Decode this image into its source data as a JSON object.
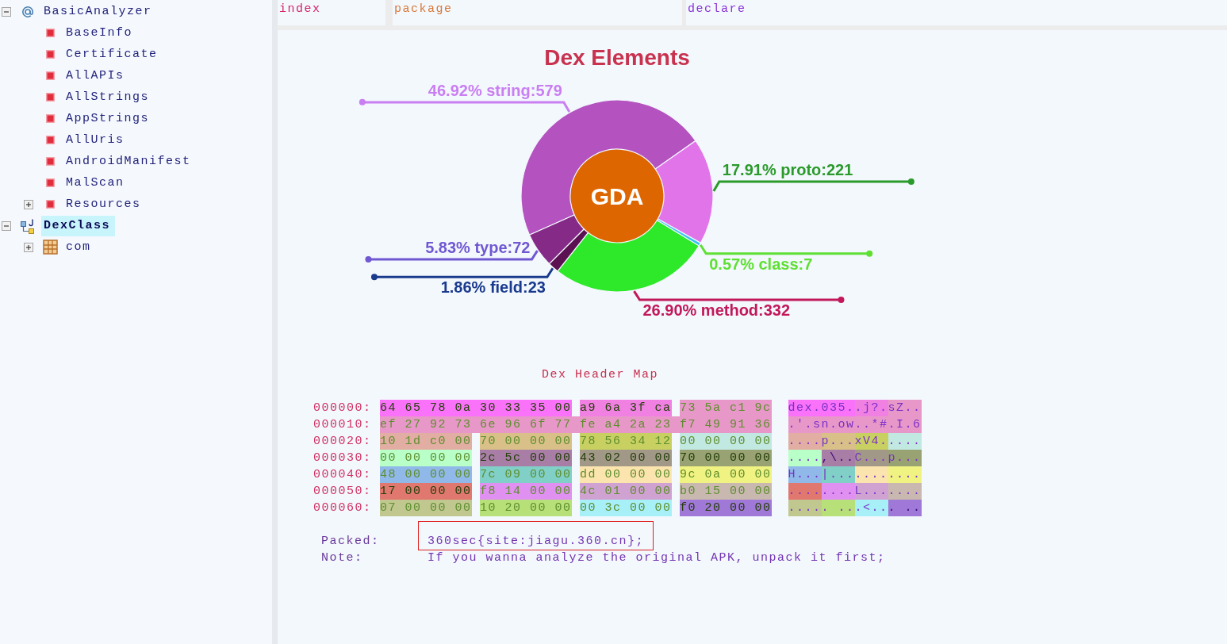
{
  "sidebar": {
    "tree": [
      {
        "label": "BasicAnalyzer",
        "kind": "analyzer",
        "expanded": true,
        "selected": false,
        "children": [
          {
            "label": "BaseInfo",
            "kind": "report",
            "selected": false
          },
          {
            "label": "Certificate",
            "kind": "report",
            "selected": false
          },
          {
            "label": "AllAPIs",
            "kind": "report",
            "selected": false
          },
          {
            "label": "AllStrings",
            "kind": "report",
            "selected": false
          },
          {
            "label": "AppStrings",
            "kind": "report",
            "selected": false
          },
          {
            "label": "AllUris",
            "kind": "report",
            "selected": false
          },
          {
            "label": "AndroidManifest",
            "kind": "report",
            "selected": false
          },
          {
            "label": "MalScan",
            "kind": "report",
            "selected": false
          },
          {
            "label": "Resources",
            "kind": "report",
            "expanded": false,
            "selected": false
          }
        ]
      },
      {
        "label": "DexClass",
        "kind": "classes",
        "expanded": true,
        "selected": true,
        "children": [
          {
            "label": "com",
            "kind": "package",
            "expanded": false,
            "selected": false
          }
        ]
      }
    ]
  },
  "columns": [
    {
      "label": "index",
      "color": "#d6246a"
    },
    {
      "label": "package",
      "color": "#d87838"
    },
    {
      "label": "declare",
      "color": "#8a32d8"
    }
  ],
  "elements_chart": {
    "chart_data": {
      "type": "donut",
      "title": "Dex Elements",
      "values": [
        579,
        221,
        7,
        332,
        23,
        72
      ],
      "value_labels": [
        "46.92% string:579",
        "17.91% proto:221",
        "0.57% class:7",
        "26.90% method:332",
        "1.86% field:23",
        "5.83% type:72"
      ]
    },
    "center_label": "GDA"
  },
  "header_map": {
    "title": "Dex Header Map",
    "rows": [
      {
        "offset": "000000:",
        "segments": [
          {
            "hex": "64 65 78 0a 30 33 35 00",
            "ascii": "dex.035.",
            "color": "#fa72fa"
          },
          {
            "hex": "a9 6a 3f ca",
            "ascii": ".j?.",
            "color": "#f080e2"
          },
          {
            "hex": "73 5a c1 9c",
            "ascii": "sZ..",
            "color": "#e898c8"
          }
        ]
      },
      {
        "offset": "000010:",
        "segments": [
          {
            "hex": "ef 27 92 73 6e 96 6f 77 fe a4 2a 23 f7 49 91 36",
            "ascii": ".'.sn.ow..*#.I.6",
            "color": "#e898c8"
          }
        ]
      },
      {
        "offset": "000020:",
        "segments": [
          {
            "hex": "10 1d c0 00",
            "ascii": "....",
            "color": "#e2ada2"
          },
          {
            "hex": "70 00 00 00",
            "ascii": "p...",
            "color": "#d8c088"
          },
          {
            "hex": "78 56 34 12",
            "ascii": "xV4.",
            "color": "#c8d062"
          },
          {
            "hex": "00 00 00 00",
            "ascii": "....",
            "color": "#c2e8e2"
          }
        ]
      },
      {
        "offset": "000030:",
        "segments": [
          {
            "hex": "00 00 00 00",
            "ascii": "....",
            "color": "#b8ffc8"
          },
          {
            "hex": "2c 5c 00 00",
            "ascii": ",\\..",
            "color": "#a87ea6"
          },
          {
            "hex": "43 02 00 00",
            "ascii": "C...",
            "color": "#a29888"
          },
          {
            "hex": "70 00 00 00",
            "ascii": "p...",
            "color": "#98a272"
          }
        ]
      },
      {
        "offset": "000040:",
        "segments": [
          {
            "hex": "48 00 00 00",
            "ascii": "H...",
            "color": "#90b8e8"
          },
          {
            "hex": "7c 09 00 00",
            "ascii": "|...",
            "color": "#80d0c8"
          },
          {
            "hex": "dd 00 00 00",
            "ascii": "....",
            "color": "#fce4ae"
          },
          {
            "hex": "9c 0a 00 00",
            "ascii": "....",
            "color": "#f0f282"
          }
        ]
      },
      {
        "offset": "000050:",
        "segments": [
          {
            "hex": "17 00 00 00",
            "ascii": "....",
            "color": "#e07870"
          },
          {
            "hex": "f8 14 00 00",
            "ascii": "....",
            "color": "#e090f0"
          },
          {
            "hex": "4c 01 00 00",
            "ascii": "L...",
            "color": "#d0a2d2"
          },
          {
            "hex": "b0 15 00 00",
            "ascii": "....",
            "color": "#c8b8b0"
          }
        ]
      },
      {
        "offset": "000060:",
        "segments": [
          {
            "hex": "07 00 00 00",
            "ascii": "....",
            "color": "#c0c890"
          },
          {
            "hex": "10 20 00 00",
            "ascii": ". ..",
            "color": "#b8e078"
          },
          {
            "hex": "00 3c 00 00",
            "ascii": ".<..",
            "color": "#a8f0f8"
          },
          {
            "hex": "f0 20 00 00",
            "ascii": ". ..",
            "color": "#a078d8"
          }
        ]
      }
    ]
  },
  "info": [
    {
      "label": "Packed:",
      "value": "360sec{site:jiagu.360.cn};",
      "highlighted": true
    },
    {
      "label": "Note:",
      "value": "If you wanna analyze the original APK, unpack it first;",
      "highlighted": false
    }
  ]
}
